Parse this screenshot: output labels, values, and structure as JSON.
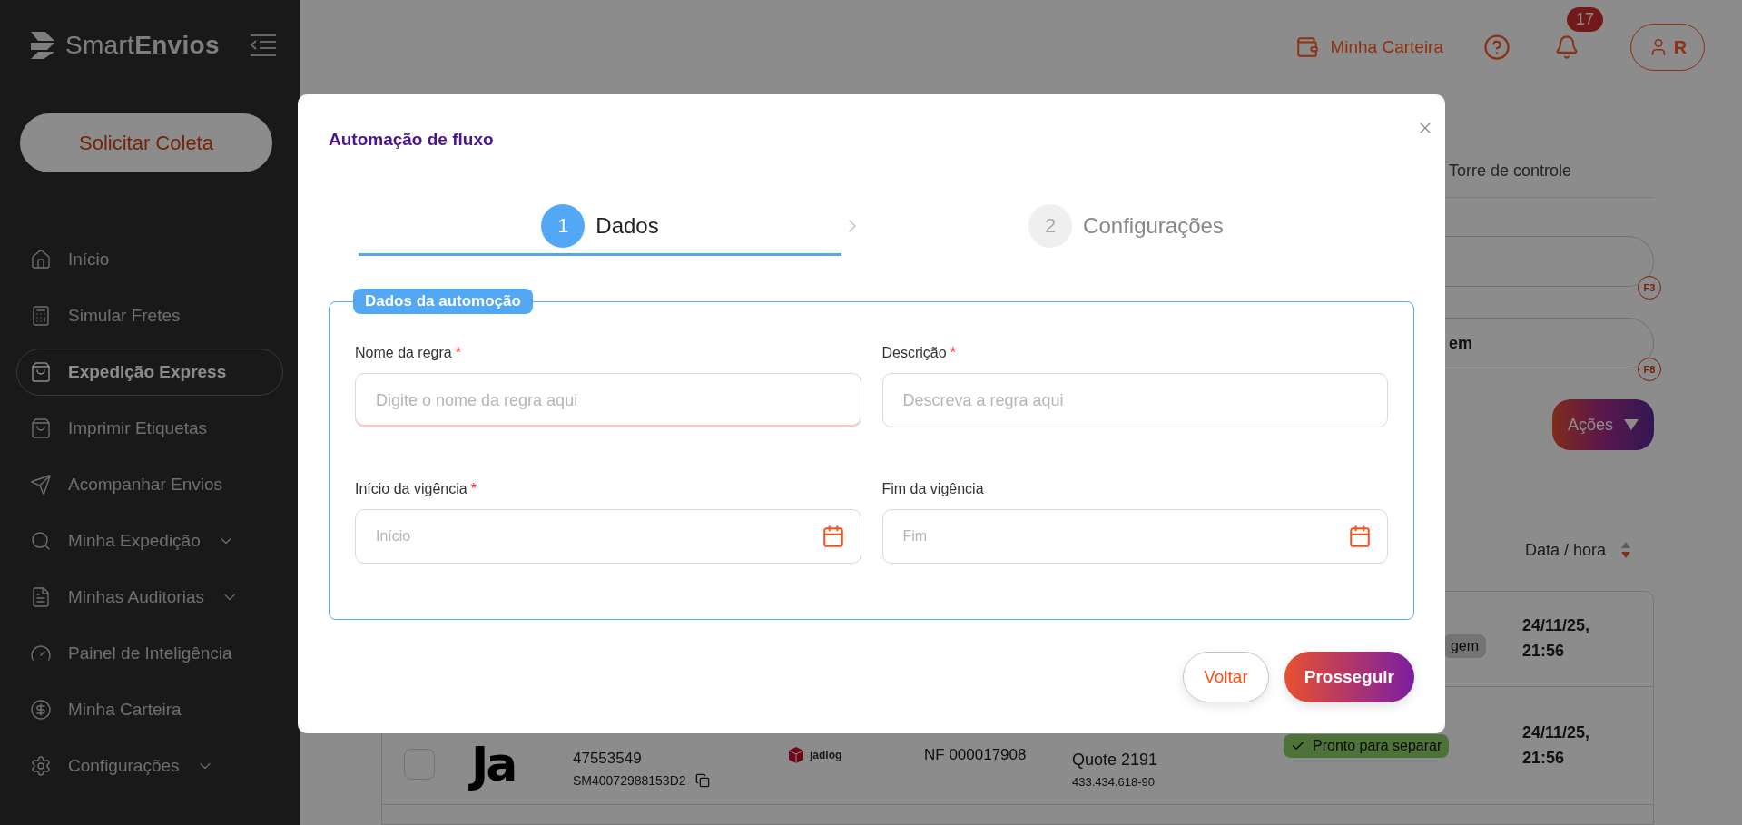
{
  "sidebar": {
    "logo": "Smart**Envios**",
    "cta": "Solicitar Coleta",
    "items": [
      {
        "label": "Início",
        "selected": false,
        "expandable": false
      },
      {
        "label": "Simular Fretes",
        "selected": false,
        "expandable": false
      },
      {
        "label": "Expedição Express",
        "selected": true,
        "expandable": false
      },
      {
        "label": "Imprimir Etiquetas",
        "selected": false,
        "expandable": false
      },
      {
        "label": "Acompanhar Envios",
        "selected": false,
        "expandable": false
      },
      {
        "label": "Minha Expedição",
        "selected": false,
        "expandable": true
      },
      {
        "label": "Minhas Auditorias",
        "selected": false,
        "expandable": true
      },
      {
        "label": "Painel de Inteligência",
        "selected": false,
        "expandable": false
      },
      {
        "label": "Minha Carteira",
        "selected": false,
        "expandable": false
      },
      {
        "label": "Configurações",
        "selected": false,
        "expandable": true
      }
    ]
  },
  "header": {
    "wallet_link": "Minha Carteira",
    "notifications": "17",
    "user_initial": "R"
  },
  "background": {
    "tab": "Torre de controle",
    "fields": [
      {
        "shortcut": "F3"
      },
      {
        "value": "em",
        "shortcut": "F8"
      }
    ],
    "actions_button": "Ações",
    "date_column": "Data / hora",
    "rows": [
      {
        "status": {
          "text": "gem",
          "kind": "neutral"
        },
        "date": "24/11/25, 21:56"
      },
      {
        "checked": false,
        "logo": "Ja",
        "order": "47553549",
        "tracking": "SM40072988153D2",
        "carrier": "jadlog",
        "invoice": "NF 000017908",
        "client": "Quote 2191",
        "document": "433.434.618-90",
        "status": {
          "text": "Pronto para separar",
          "kind": "ready"
        },
        "date": "24/11/25, 21:56"
      }
    ]
  },
  "modal": {
    "title": "Automação de fluxo",
    "required_mark": "*",
    "steps": [
      {
        "number": "1",
        "label": "Dados",
        "selected": true
      },
      {
        "number": "2",
        "label": "Configurações",
        "selected": false
      }
    ],
    "section": "Dados da automoção",
    "fields": [
      {
        "label": "Nome da regra",
        "required": true,
        "placeholder": "Digite o nome da regra aqui",
        "kind": "text",
        "error": true
      },
      {
        "label": "Descrição",
        "required": true,
        "placeholder": "Descreva a regra aqui",
        "kind": "text",
        "error": false
      },
      {
        "label": "Início da vigência",
        "required": true,
        "placeholder": "Início",
        "kind": "date",
        "error": false
      },
      {
        "label": "Fim da vigência",
        "required": false,
        "placeholder": "Fim",
        "kind": "date",
        "error": false
      }
    ],
    "buttons": [
      {
        "label": "Voltar",
        "kind": "secondary"
      },
      {
        "label": "Prosseguir",
        "kind": "primary"
      }
    ]
  }
}
